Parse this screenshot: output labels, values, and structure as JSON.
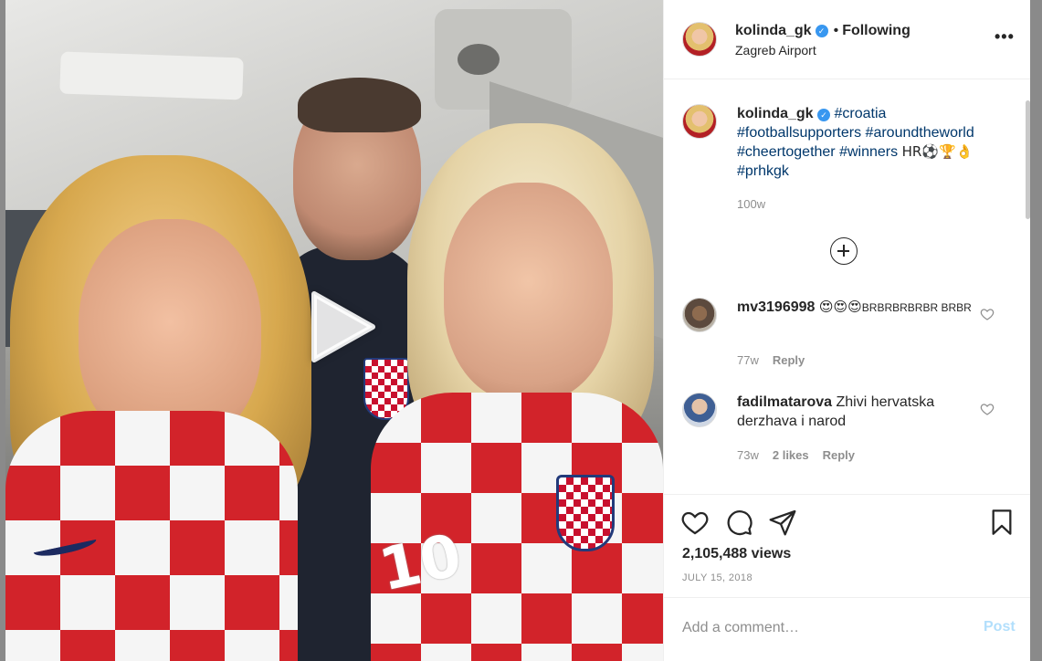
{
  "post": {
    "username": "kolinda_gk",
    "verified_mark": "✓",
    "separator": "•",
    "follow_label": "Following",
    "location": "Zagreb Airport",
    "more_label": "•••"
  },
  "caption": {
    "username": "kolinda_gk",
    "tags": [
      "#croatia",
      "#footballsupporters",
      "#aroundtheworld",
      "#cheertogether",
      "#winners"
    ],
    "emoji_text": "HR⚽🏆👌",
    "last_tag": "#prhkgk",
    "time": "100w"
  },
  "comments": [
    {
      "username": "mv3196998",
      "text_emoji": "😍😍😍",
      "text_small": "BRBRBRBRBR BRBR",
      "time": "77w",
      "reply_label": "Reply"
    },
    {
      "username": "fadilmatarova",
      "text": "Zhivi hervatska derzhava i narod",
      "time": "73w",
      "likes_label": "2 likes",
      "reply_label": "Reply"
    }
  ],
  "stats": {
    "views": "2,105,488 views",
    "date": "JULY 15, 2018"
  },
  "add_comment": {
    "placeholder": "Add a comment…",
    "post_label": "Post"
  },
  "media": {
    "jersey_number": "10"
  },
  "colors": {
    "verified": "#3897f0",
    "hashtag": "#00376b",
    "post_disabled": "#b2dffc",
    "muted_text": "#8e8e8e"
  },
  "icons": [
    "play-icon",
    "heart-icon",
    "comment-icon",
    "share-icon",
    "bookmark-icon",
    "add-circle-icon",
    "more-options-icon",
    "verified-badge-icon"
  ]
}
